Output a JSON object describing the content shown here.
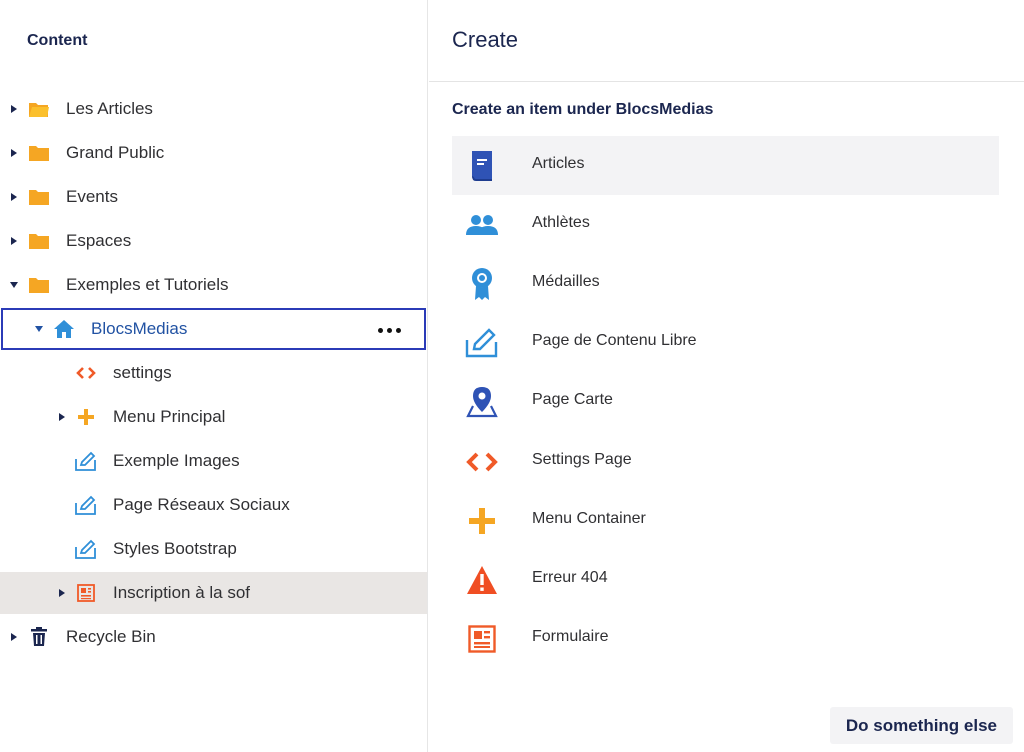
{
  "tree": {
    "heading": "Content",
    "items": [
      {
        "label": "Les Articles"
      },
      {
        "label": "Grand Public"
      },
      {
        "label": "Events"
      },
      {
        "label": "Espaces"
      },
      {
        "label": "Exemples et Tutoriels"
      },
      {
        "label": "BlocsMedias"
      },
      {
        "label": "settings"
      },
      {
        "label": "Menu Principal"
      },
      {
        "label": "Exemple Images"
      },
      {
        "label": "Page Réseaux Sociaux"
      },
      {
        "label": "Styles Bootstrap"
      },
      {
        "label": "Inscription à la sof"
      },
      {
        "label": "Recycle Bin"
      }
    ]
  },
  "create": {
    "title": "Create",
    "subtitle": "Create an item under BlocsMedias",
    "items": [
      {
        "label": "Articles",
        "icon": "book-icon"
      },
      {
        "label": "Athlètes",
        "icon": "users-icon"
      },
      {
        "label": "Médailles",
        "icon": "medal-icon"
      },
      {
        "label": "Page de Contenu Libre",
        "icon": "edit-icon"
      },
      {
        "label": "Page Carte",
        "icon": "map-pin-icon"
      },
      {
        "label": "Settings Page",
        "icon": "code-icon"
      },
      {
        "label": "Menu Container",
        "icon": "plus-icon"
      },
      {
        "label": "Erreur 404",
        "icon": "warning-icon"
      },
      {
        "label": "Formulaire",
        "icon": "form-icon"
      }
    ],
    "action_label": "Do something else"
  },
  "colors": {
    "folder": "#f5a623",
    "accent_blue": "#2152a3",
    "selection_border": "#2b3bb7",
    "code_red": "#f05a28",
    "plus_orange": "#f5a623",
    "warning_red": "#f04e23",
    "icon_blue": "#2f53b5",
    "icon_light_blue": "#2f8fd8"
  }
}
